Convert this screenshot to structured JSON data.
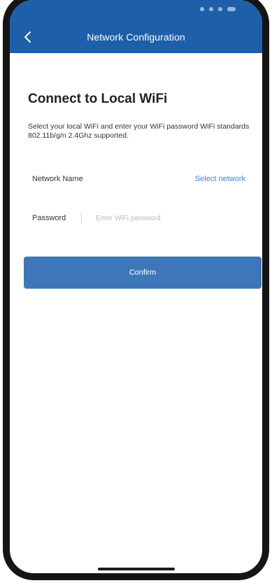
{
  "header": {
    "title": "Network Configuration",
    "back_icon": "chevron-left-icon",
    "background_color": "#1d5fa8"
  },
  "main": {
    "title": "Connect to Local WiFi",
    "description": "Select your local WiFi and enter your WiFi password WiFi standards 802.11b/g/n 2.4Ghz supported.",
    "network_label": "Network Name",
    "select_network_label": "Select network",
    "password_label": "Password",
    "password_placeholder": "Enter WiFi password",
    "password_value": "",
    "confirm_label": "Confirm",
    "accent_color": "#3b86d6",
    "button_color": "#3e77b8"
  }
}
